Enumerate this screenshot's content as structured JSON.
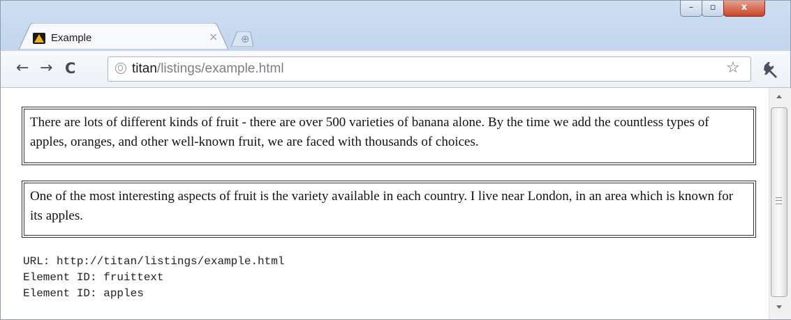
{
  "tab": {
    "title": "Example",
    "close_glyph": "×"
  },
  "toolbar": {
    "url_host": "titan",
    "url_path": "/listings/example.html",
    "back_glyph": "←",
    "forward_glyph": "→",
    "reload_glyph": "C",
    "bookmark_glyph": "☆"
  },
  "window_controls": {
    "minimize": "–",
    "maximize": "▫",
    "close": "x"
  },
  "content": {
    "paragraphs": [
      {
        "id": "fruittext",
        "text": "There are lots of different kinds of fruit - there are over 500 varieties of banana alone. By the time we add the countless types of apples, oranges, and other well-known fruit, we are faced with thousands of choices."
      },
      {
        "id": "apples",
        "text": "One of the most interesting aspects of fruit is the variety available in each country. I live near London, in an area which is known for its apples."
      }
    ],
    "log": [
      "URL: http://titan/listings/example.html",
      "Element ID: fruittext",
      "Element ID: apples"
    ]
  },
  "colors": {
    "frame": "#b8cde8",
    "close_button": "#c8442b",
    "paragraph_border": "#333333"
  },
  "icons": [
    "app-favicon",
    "new-tab-icon",
    "back-arrow-icon",
    "forward-arrow-icon",
    "reload-icon",
    "globe-icon",
    "star-icon",
    "wrench-icon"
  ]
}
